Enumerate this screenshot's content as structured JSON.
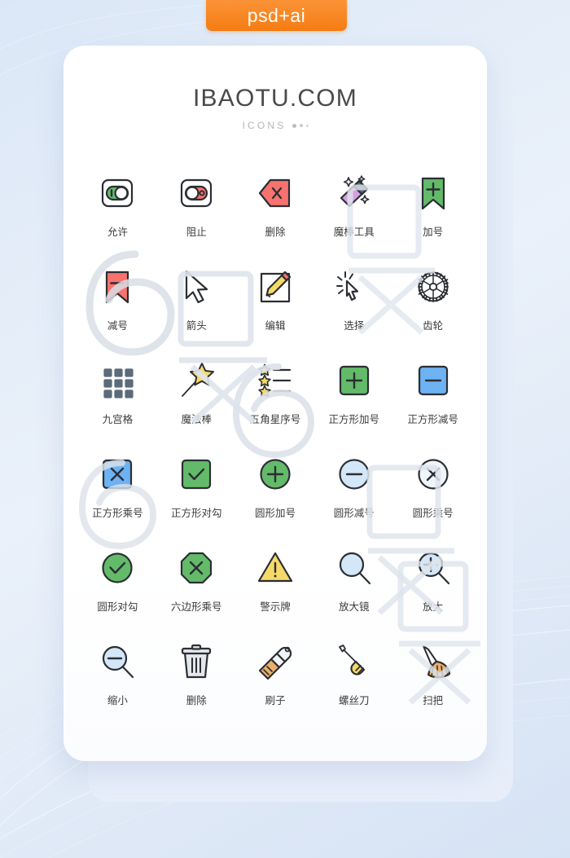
{
  "badge": {
    "label": "psd+ai",
    "color": "#f57c12"
  },
  "header": {
    "brand": "IBAOTU.COM",
    "subtitle": "ICONS"
  },
  "theme": {
    "background": "#e3ecf8",
    "card": "#ffffff",
    "card_back": "#e7eefa",
    "label": "#3b3b3b",
    "green": "#63bb6a",
    "red": "#f8736e",
    "blue": "#6db2f2",
    "light_blue": "#d3e7f8",
    "yellow": "#f5da6a",
    "purple": "#d6a0e0",
    "slate": "#5b6b7a",
    "orange": "#eab06a",
    "ink": "#2b2e33"
  },
  "icons": [
    {
      "name": "allow-toggle",
      "label": "允许",
      "key": "toggle-on"
    },
    {
      "name": "block-toggle",
      "label": "阻止",
      "key": "toggle-off"
    },
    {
      "name": "delete-tag",
      "label": "删除",
      "key": "tag-x"
    },
    {
      "name": "magic-wand-tool",
      "label": "魔棒工具",
      "key": "wand-tool"
    },
    {
      "name": "plus-bookmark",
      "label": "加号",
      "key": "bookmark-plus"
    },
    {
      "name": "minus-bookmark",
      "label": "减号",
      "key": "bookmark-minus"
    },
    {
      "name": "arrow-cursor",
      "label": "箭头",
      "key": "cursor"
    },
    {
      "name": "edit-pencil",
      "label": "编辑",
      "key": "edit"
    },
    {
      "name": "select-click",
      "label": "选择",
      "key": "select"
    },
    {
      "name": "gear",
      "label": "齿轮",
      "key": "gear"
    },
    {
      "name": "nine-grid",
      "label": "九宫格",
      "key": "grid9"
    },
    {
      "name": "magic-stick",
      "label": "魔法棒",
      "key": "magic-stick"
    },
    {
      "name": "star-ordered-list",
      "label": "五角星序号",
      "key": "star-list"
    },
    {
      "name": "square-plus",
      "label": "正方形加号",
      "key": "sq-plus"
    },
    {
      "name": "square-minus",
      "label": "正方形减号",
      "key": "sq-minus"
    },
    {
      "name": "square-multiply",
      "label": "正方形乘号",
      "key": "sq-x"
    },
    {
      "name": "square-check",
      "label": "正方形对勾",
      "key": "sq-check"
    },
    {
      "name": "circle-plus",
      "label": "圆形加号",
      "key": "ci-plus"
    },
    {
      "name": "circle-minus",
      "label": "圆形减号",
      "key": "ci-minus"
    },
    {
      "name": "circle-multiply",
      "label": "圆形乘号",
      "key": "ci-x"
    },
    {
      "name": "circle-check",
      "label": "圆形对勾",
      "key": "ci-check"
    },
    {
      "name": "hexagon-multiply",
      "label": "六边形乘号",
      "key": "oct-x"
    },
    {
      "name": "warning-sign",
      "label": "警示牌",
      "key": "warning"
    },
    {
      "name": "magnifier",
      "label": "放大镜",
      "key": "magnifier"
    },
    {
      "name": "zoom-in",
      "label": "放大",
      "key": "zoom-in"
    },
    {
      "name": "zoom-out",
      "label": "缩小",
      "key": "zoom-out"
    },
    {
      "name": "trash-delete",
      "label": "删除",
      "key": "trash"
    },
    {
      "name": "paint-brush",
      "label": "刷子",
      "key": "brush"
    },
    {
      "name": "screwdriver",
      "label": "螺丝刀",
      "key": "screwdriver"
    },
    {
      "name": "broom",
      "label": "扫把",
      "key": "broom"
    }
  ]
}
